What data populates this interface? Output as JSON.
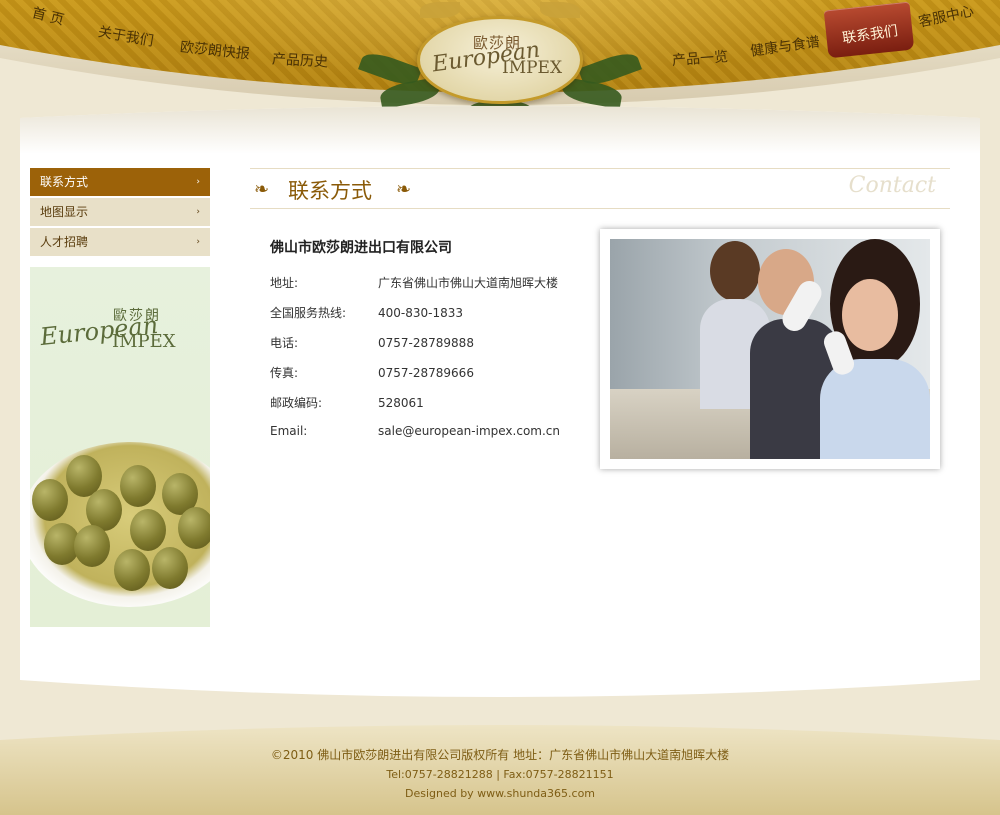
{
  "nav": {
    "home": "首 页",
    "about": "关于我们",
    "news": "欧莎朗快报",
    "history": "产品历史",
    "products": "产品一览",
    "health": "健康与食谱",
    "contact": "联系我们",
    "service": "客服中心"
  },
  "logo": {
    "cn": "歐莎朗",
    "en1": "European",
    "en2": "IMPEX"
  },
  "sidebar": {
    "items": [
      {
        "label": "联系方式",
        "active": true
      },
      {
        "label": "地图显示",
        "active": false
      },
      {
        "label": "人才招聘",
        "active": false
      }
    ],
    "arrow": "›",
    "brand_cn": "歐莎朗",
    "brand_en1": "European",
    "brand_en2": "IMPEX"
  },
  "section": {
    "title": "联系方式",
    "subtitle": "Contact"
  },
  "contact": {
    "company": "佛山市欧莎朗进出口有限公司",
    "rows": [
      {
        "label": "地址:",
        "value": "广东省佛山市佛山大道南旭晖大楼"
      },
      {
        "label": "全国服务热线:",
        "value": "400-830-1833"
      },
      {
        "label": "电话:",
        "value": "0757-28789888"
      },
      {
        "label": "传真:",
        "value": "0757-28789666"
      },
      {
        "label": "邮政编码:",
        "value": "528061"
      },
      {
        "label": "Email:",
        "value": "sale@european-impex.com.cn"
      }
    ]
  },
  "footer": {
    "line1": "©2010 佛山市欧莎朗进出有限公司版权所有   地址：广东省佛山市佛山大道南旭晖大楼",
    "line2": "Tel:0757-28821288 | Fax:0757-28821151",
    "line3": "Designed by www.shunda365.com"
  },
  "colors": {
    "header_gold": "#b8860b",
    "menu_active": "#9c6209",
    "title_brown": "#8a5a08"
  }
}
